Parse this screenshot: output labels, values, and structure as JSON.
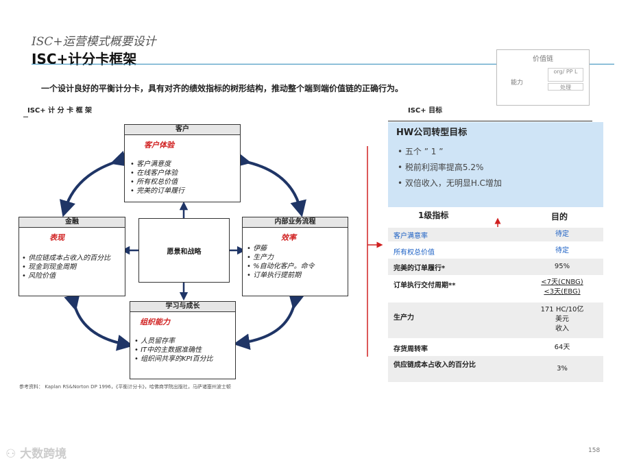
{
  "header": {
    "subtitle": "ISC+运营模式概要设计",
    "title": "ISC+计分卡框架",
    "lead": "一个设计良好的平衡计分卡，具有对齐的绩效指标的树形结构，推动整个端到端价值链的正确行为。"
  },
  "thumbnail": {
    "heading": "价值链",
    "label": "能力",
    "box1": "org/ PP L",
    "box2": "处理"
  },
  "left_section_title": "ISC+ 计 分 卡 框 架",
  "right_section_title": "ISC+ 目标",
  "scorecard": {
    "customer": {
      "header": "客户",
      "focus": "客户体验",
      "items": [
        "客户满意度",
        "在线客户体验",
        "所有权总价值",
        "完美的订单履行"
      ]
    },
    "finance": {
      "header": "金融",
      "focus": "表现",
      "items": [
        "供应链成本占收入的百分比",
        "现金到现金周期",
        "风险价值"
      ]
    },
    "process": {
      "header": "内部业务流程",
      "focus": "效率",
      "items": [
        "伊藤",
        "生产力",
        "%自动化客户。命令",
        "订单执行提前期"
      ]
    },
    "learning": {
      "header": "学习与成长",
      "focus": "组织能力",
      "items": [
        "人员留存率",
        "IT中的主数据准确性",
        "组织间共享的KPI百分比"
      ]
    },
    "center": "愿景和战略"
  },
  "goals": {
    "title": "HW公司转型目标",
    "items": [
      "五个 ” 1 ”",
      "税前利润率提高5.2%",
      "双倍收入，无明显H.C增加"
    ]
  },
  "table": {
    "col1": "1级指标",
    "col2": "目的",
    "rows": [
      {
        "metric": "客户满意率",
        "target": "待定"
      },
      {
        "metric": "所有权总价值",
        "target": "待定"
      },
      {
        "metric": "完美的订单履行*",
        "target": "95%"
      },
      {
        "metric": "订单执行交付周期**",
        "target1": "<7天(CNBG)",
        "target2": "<3天(EBG)"
      },
      {
        "metric": "生产力",
        "target1": "171 HC/10亿",
        "target2": "美元",
        "target3": "收入"
      },
      {
        "metric": "存货周转率",
        "target": "64天"
      },
      {
        "metric": "供应链成本占收入的百分比",
        "target": "3%"
      }
    ]
  },
  "reference": "参考资料： Kaplan RS&Norton DP 1996，《平衡计分卡》，哈佛商学院出版社，马萨诸塞州波士顿",
  "page_number": "158",
  "watermark": "大数跨境",
  "colors": {
    "accent_blue": "#2e89b8",
    "panel_blue": "#cfe4f6",
    "red": "#d02020",
    "arrow_navy": "#1f3566",
    "link_blue": "#1a5fc4"
  }
}
